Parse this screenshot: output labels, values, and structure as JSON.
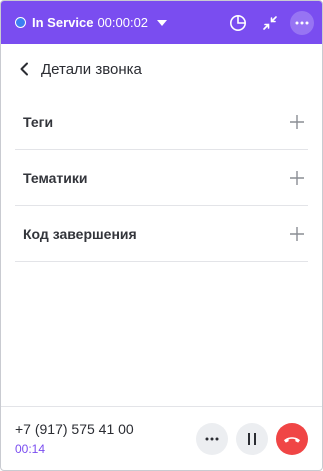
{
  "header": {
    "status_label": "In Service",
    "timer": "00:00:02",
    "colors": {
      "background": "#7a4df0",
      "status_dot": "#3d7ff2"
    },
    "icons": [
      "chevron-down-icon",
      "pie-chart-icon",
      "minimize-icon",
      "more-icon"
    ]
  },
  "page": {
    "title": "Детали звонка",
    "back_icon": "chevron-left-icon"
  },
  "sections": [
    {
      "label": "Теги",
      "icon": "plus-icon"
    },
    {
      "label": "Тематики",
      "icon": "plus-icon"
    },
    {
      "label": "Код завершения",
      "icon": "plus-icon"
    }
  ],
  "footer": {
    "phone": "+7 (917) 575 41 00",
    "call_duration": "00:14",
    "buttons": [
      "more-icon",
      "pause-icon",
      "hangup-icon"
    ],
    "colors": {
      "duration": "#7a4df0",
      "hangup": "#f04545"
    }
  }
}
